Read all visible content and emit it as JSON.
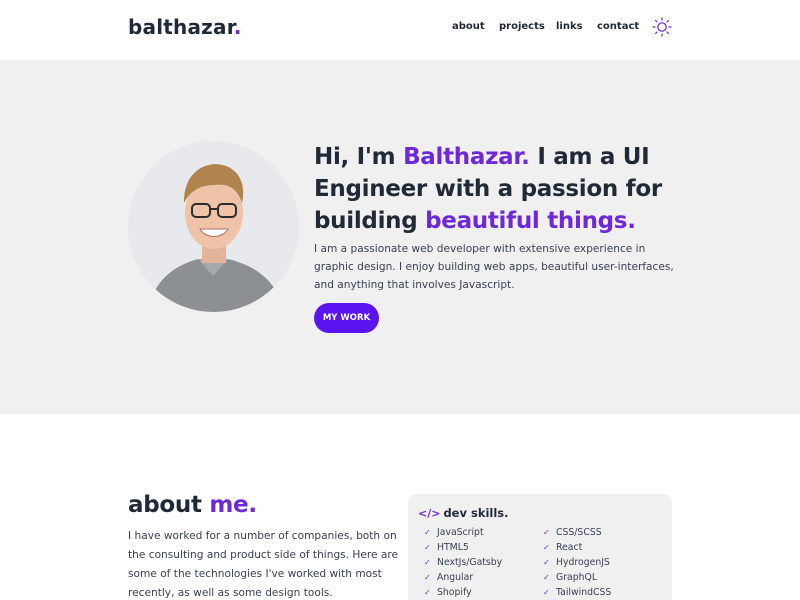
{
  "header": {
    "logo_text": "balthazar",
    "logo_dot": ".",
    "nav": [
      {
        "label": "about"
      },
      {
        "label": "projects"
      },
      {
        "label": "links"
      },
      {
        "label": "contact"
      }
    ],
    "theme_icon": "sun-icon"
  },
  "hero": {
    "title_part1": "Hi, I'm ",
    "title_name": "Balthazar.",
    "title_part2": " I am a UI Engineer with a passion for building ",
    "title_highlight": "beautiful things.",
    "description": "I am a passionate web developer with extensive experience in graphic design. I enjoy building web apps, beautiful user-interfaces, and anything that involves Javascript.",
    "button_label": "MY WORK",
    "avatar_icon": "portrait-photo"
  },
  "about": {
    "title_part1": "about ",
    "title_part2": "me.",
    "text": "I have worked for a number of companies, both on the consulting and product side of things. Here are some of the technologies I've worked with most recently, as well as some design tools.",
    "skills_icon": "code-icon",
    "skills_title": "dev skills.",
    "skills_col1": [
      "JavaScript",
      "HTML5",
      "NextJs/Gatsby",
      "Angular",
      "Shopify"
    ],
    "skills_col2": [
      "CSS/SCSS",
      "React",
      "HydrogenJS",
      "GraphQL",
      "TailwindCSS"
    ]
  },
  "colors": {
    "accent": "#6d28d9",
    "button": "#5b14f0",
    "hero_bg": "#f0f0f1",
    "text": "#1f2937"
  }
}
